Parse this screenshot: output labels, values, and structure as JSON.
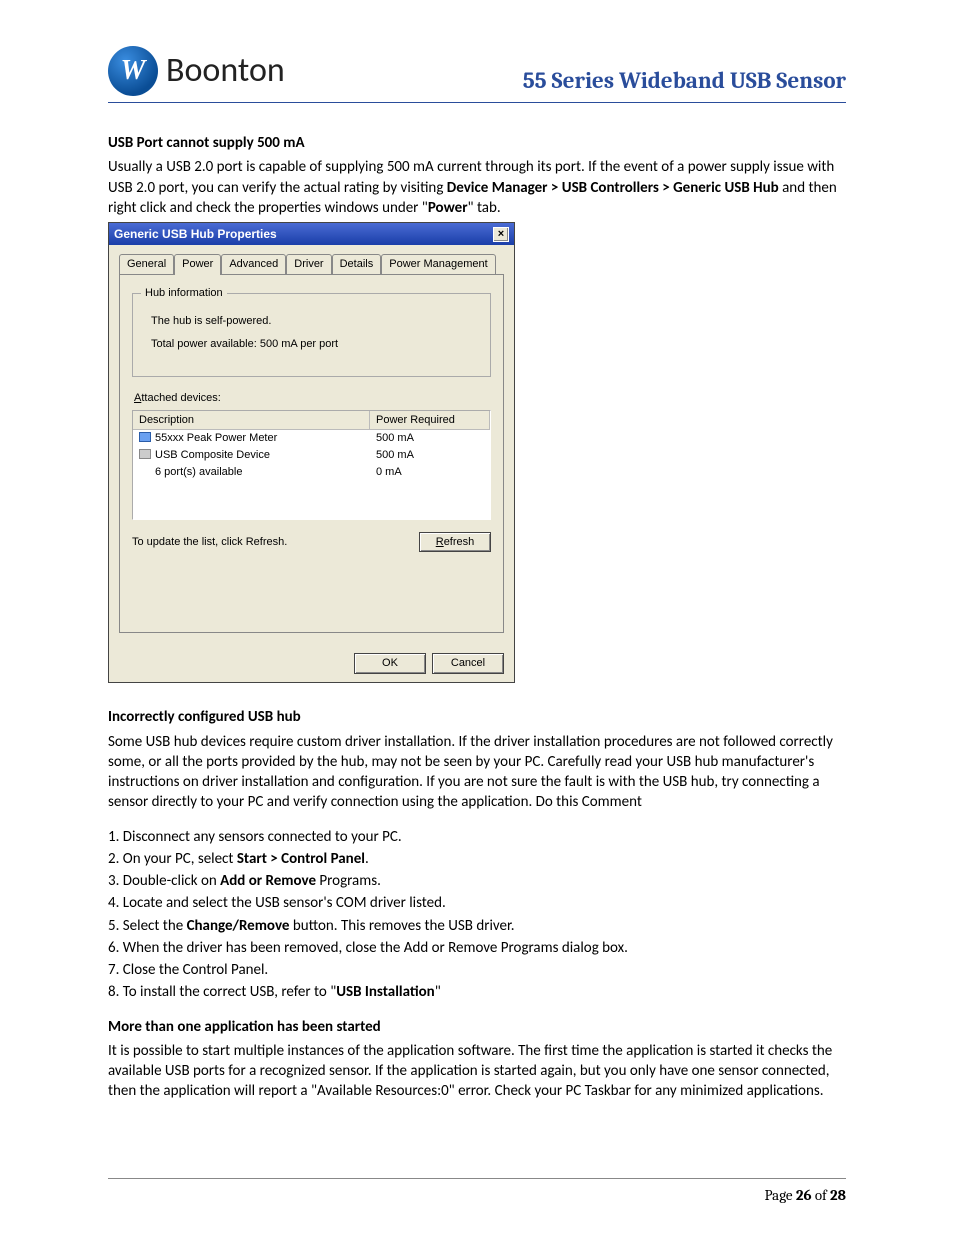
{
  "header": {
    "logo_mark": "W",
    "logo_text": "Boonton",
    "doc_title": "55 Series Wideband USB Sensor"
  },
  "section1": {
    "heading": "USB Port cannot supply 500 mA",
    "para_part1": "Usually a USB 2.0 port is capable of supplying 500 mA current through its port. If the event of a power supply issue with USB 2.0 port, you can verify the actual rating by visiting ",
    "para_bold": "Device Manager > USB Controllers > Generic USB Hub",
    "para_part2": " and then right click and check the properties windows under \"",
    "para_bold2": "Power",
    "para_part3": "\" tab."
  },
  "dialog": {
    "title": "Generic USB Hub Properties",
    "close": "×",
    "tabs": [
      "General",
      "Power",
      "Advanced",
      "Driver",
      "Details",
      "Power Management"
    ],
    "active_tab": 1,
    "group_legend": "Hub information",
    "hub_line1": "The hub is self-powered.",
    "hub_line2": "Total power available: 500 mA per port",
    "attached_label_prefix": "A",
    "attached_label_rest": "ttached devices:",
    "columns": {
      "desc": "Description",
      "power": "Power Required"
    },
    "rows": [
      {
        "icon": "blue",
        "desc": "55xxx Peak Power Meter",
        "power": "500 mA"
      },
      {
        "icon": "grey",
        "desc": "USB Composite Device",
        "power": "500 mA"
      },
      {
        "icon": "none",
        "desc": "6 port(s) available",
        "power": "0 mA"
      }
    ],
    "refresh_hint": "To update the list, click Refresh.",
    "refresh_btn_prefix": "R",
    "refresh_btn_rest": "efresh",
    "ok": "OK",
    "cancel": "Cancel"
  },
  "section2": {
    "heading": "Incorrectly configured USB hub",
    "para": "Some USB hub devices require custom driver installation. If the driver installation procedures are not followed correctly some, or all the ports provided by the hub, may not be seen by your PC. Carefully read your USB hub manufacturer's instructions on driver installation and configuration. If you are not sure the fault is with the USB hub, try connecting a sensor directly to your PC and verify connection using the application. Do this Comment"
  },
  "steps": [
    {
      "pre": "1. Disconnect any sensors connected to your PC."
    },
    {
      "pre": "2. On your PC, select ",
      "bold": "Start > Control Panel",
      "post": "."
    },
    {
      "pre": "3. Double-click on ",
      "bold": "Add or Remove",
      "post": " Programs."
    },
    {
      "pre": "4. Locate and select the USB sensor's  COM driver listed."
    },
    {
      "pre": "5. Select the ",
      "bold": "Change/Remove",
      "post": " button. This removes the USB driver."
    },
    {
      "pre": "6. When the driver has been removed, close the Add or Remove Programs dialog box."
    },
    {
      "pre": "7. Close the Control Panel."
    },
    {
      "pre": "8. To install the correct USB, refer to \"",
      "bold": "USB Installation",
      "post": "\""
    }
  ],
  "section3": {
    "heading": "More than one application has been started",
    "para": "It is possible to start multiple instances of the application software. The first time the application is started it checks the available USB ports for a recognized sensor. If the application is started again, but you only have one sensor connected, then the application will report a \"Available Resources:0\" error. Check your PC Taskbar for any minimized applications."
  },
  "footer": {
    "prefix": "Page ",
    "current": "26",
    "mid": " of ",
    "total": "28"
  }
}
